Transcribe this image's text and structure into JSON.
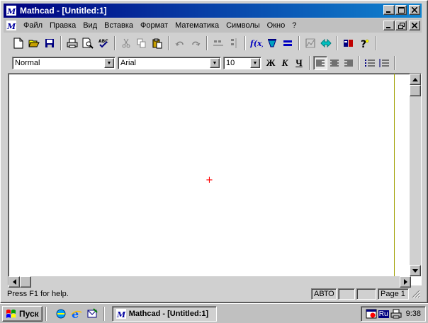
{
  "window": {
    "title": "Mathcad - [Untitled:1]",
    "icon": "mathcad-icon",
    "controls": [
      "minimize",
      "maximize",
      "close"
    ]
  },
  "menu": {
    "items": [
      "Файл",
      "Правка",
      "Вид",
      "Вставка",
      "Формат",
      "Математика",
      "Символы",
      "Окно",
      "?"
    ]
  },
  "toolbar": {
    "buttons": [
      "new-icon",
      "open-icon",
      "save-icon",
      "print-icon",
      "print-preview-icon",
      "spellcheck-icon",
      "cut-icon",
      "copy-icon",
      "paste-icon",
      "undo-icon",
      "redo-icon",
      "align-across-icon",
      "align-down-icon",
      "insert-function-icon",
      "insert-unit-icon",
      "calculate-icon",
      "insert-graph-icon",
      "insert-component-icon",
      "resources-icon",
      "help-icon"
    ]
  },
  "format": {
    "style": "Normal",
    "font": "Arial",
    "size": "10",
    "bold": "Ж",
    "italic": "К",
    "underline": "Ч"
  },
  "status": {
    "help": "Press F1 for help.",
    "mode": "АВТО",
    "page": "Page 1"
  },
  "taskbar": {
    "start": "Пуск",
    "task": "Mathcad - [Untitled:1]",
    "lang": "Ru",
    "time": "9:38"
  },
  "colors": {
    "title_active": "#000080",
    "title_gradient": "#1084d0",
    "face": "#c0c0c0",
    "cursor": "#ff0000",
    "page_edge": "#a0a000"
  }
}
